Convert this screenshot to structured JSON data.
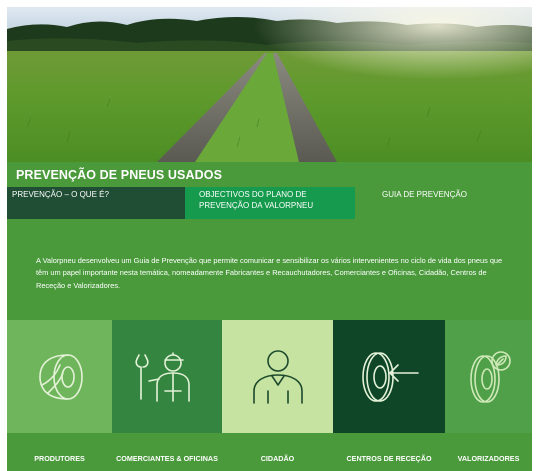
{
  "page": {
    "title": "PREVENÇÃO DE PNEUS USADOS"
  },
  "hero": {
    "image_name": "green-field-road-photo"
  },
  "tabs": [
    {
      "label": "PREVENÇÃO – O QUE É?"
    },
    {
      "label": "OBJECTIVOS DO PLANO DE PREVENÇÃO DA VALORPNEU"
    },
    {
      "label": "GUIA DE PREVENÇÃO"
    }
  ],
  "intro": {
    "text": "A Valorpneu desenvolveu um Guia de Prevenção que permite comunicar e sensibilizar os vários intervenientes no ciclo de vida dos pneus que têm um papel importante nesta temática, nomeadamente Fabricantes e Recauchutadores, Comerciantes e Oficinas, Cidadão, Centros de Receção e Valorizadores."
  },
  "categories": [
    {
      "label": "PRODUTORES",
      "icon": "tire-icon"
    },
    {
      "label": "COMERCIANTES & OFICINAS",
      "icon": "mechanic-icon"
    },
    {
      "label": "CIDADÃO",
      "icon": "citizen-icon"
    },
    {
      "label": "CENTROS DE RECEÇÃO",
      "icon": "tire-arrow-icon"
    },
    {
      "label": "VALORIZADORES",
      "icon": "tire-leaf-icon"
    }
  ],
  "colors": {
    "page_green": "#4a9a3c",
    "tab_dark": "#1f4e34",
    "tab_active": "#169a4d",
    "tile_produtores": "#6fb55c",
    "tile_comerciantes": "#33853f",
    "tile_cidadao": "#c6e3a2",
    "tile_centros": "#0f4628",
    "tile_valorizadores": "#4fa049"
  }
}
